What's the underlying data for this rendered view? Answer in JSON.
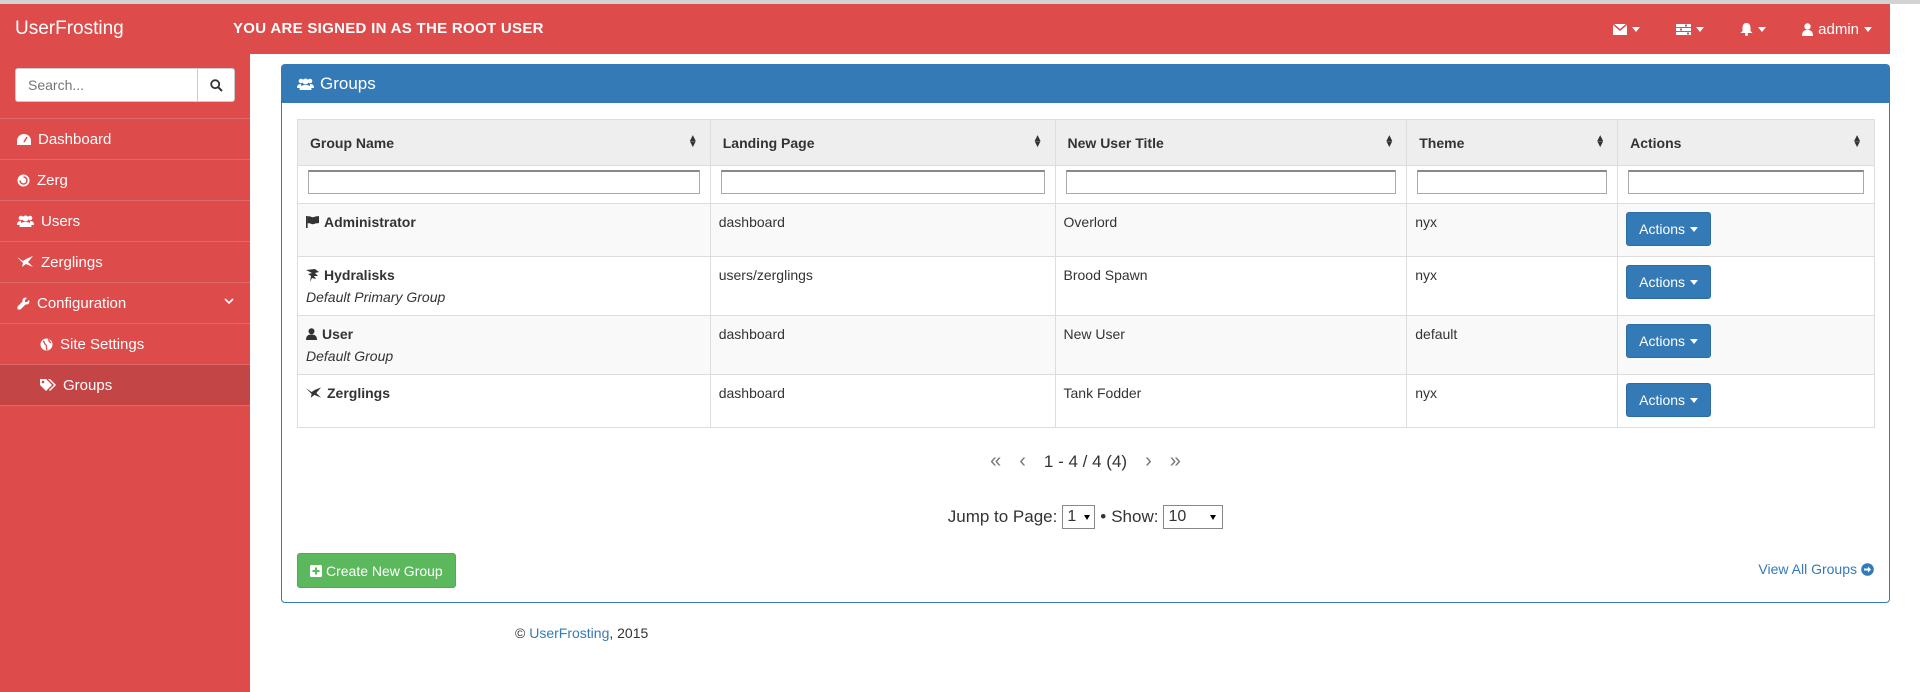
{
  "header": {
    "brand": "UserFrosting",
    "signed_in_notice": "YOU ARE SIGNED IN AS THE ROOT USER",
    "nav": {
      "messages_icon": "envelope-icon",
      "tasks_icon": "tasks-icon",
      "alerts_icon": "bell-icon",
      "user_label": "admin"
    }
  },
  "sidebar": {
    "search_placeholder": "Search...",
    "items": [
      {
        "label": "Dashboard",
        "icon": "dashboard-icon"
      },
      {
        "label": "Zerg",
        "icon": "zerg-icon"
      },
      {
        "label": "Users",
        "icon": "users-icon"
      },
      {
        "label": "Zerglings",
        "icon": "zergling-icon"
      },
      {
        "label": "Configuration",
        "icon": "wrench-icon"
      },
      {
        "label": "Site Settings",
        "icon": "globe-icon"
      },
      {
        "label": "Groups",
        "icon": "tags-icon"
      }
    ]
  },
  "panel": {
    "title": "Groups",
    "columns": [
      "Group Name",
      "Landing Page",
      "New User Title",
      "Theme",
      "Actions"
    ],
    "rows": [
      {
        "name": "Administrator",
        "subtitle": "",
        "icon": "flag-icon",
        "landing": "dashboard",
        "title": "Overlord",
        "theme": "nyx",
        "action": "Actions"
      },
      {
        "name": "Hydralisks",
        "subtitle": "Default Primary Group",
        "icon": "hydralisk-icon",
        "landing": "users/zerglings",
        "title": "Brood Spawn",
        "theme": "nyx",
        "action": "Actions"
      },
      {
        "name": "User",
        "subtitle": "Default Group",
        "icon": "user-icon",
        "landing": "dashboard",
        "title": "New User",
        "theme": "default",
        "action": "Actions"
      },
      {
        "name": "Zerglings",
        "subtitle": "",
        "icon": "zergling-icon",
        "landing": "dashboard",
        "title": "Tank Fodder",
        "theme": "nyx",
        "action": "Actions"
      }
    ],
    "pager": {
      "range": "1 - 4 / 4 (4)",
      "first": "«",
      "prev": "‹",
      "next": "›",
      "last": "»"
    },
    "jump_label": "Jump to Page:",
    "jump_value": "1",
    "separator": "•",
    "show_label": "Show:",
    "show_value": "10",
    "create_button": "Create New Group",
    "view_all": "View All Groups"
  },
  "footer": {
    "copyright": "©",
    "link": "UserFrosting",
    "year": ", 2015"
  },
  "colors": {
    "header": "#dd4b4b",
    "panel": "#337ab7",
    "create": "#5cb85c"
  }
}
